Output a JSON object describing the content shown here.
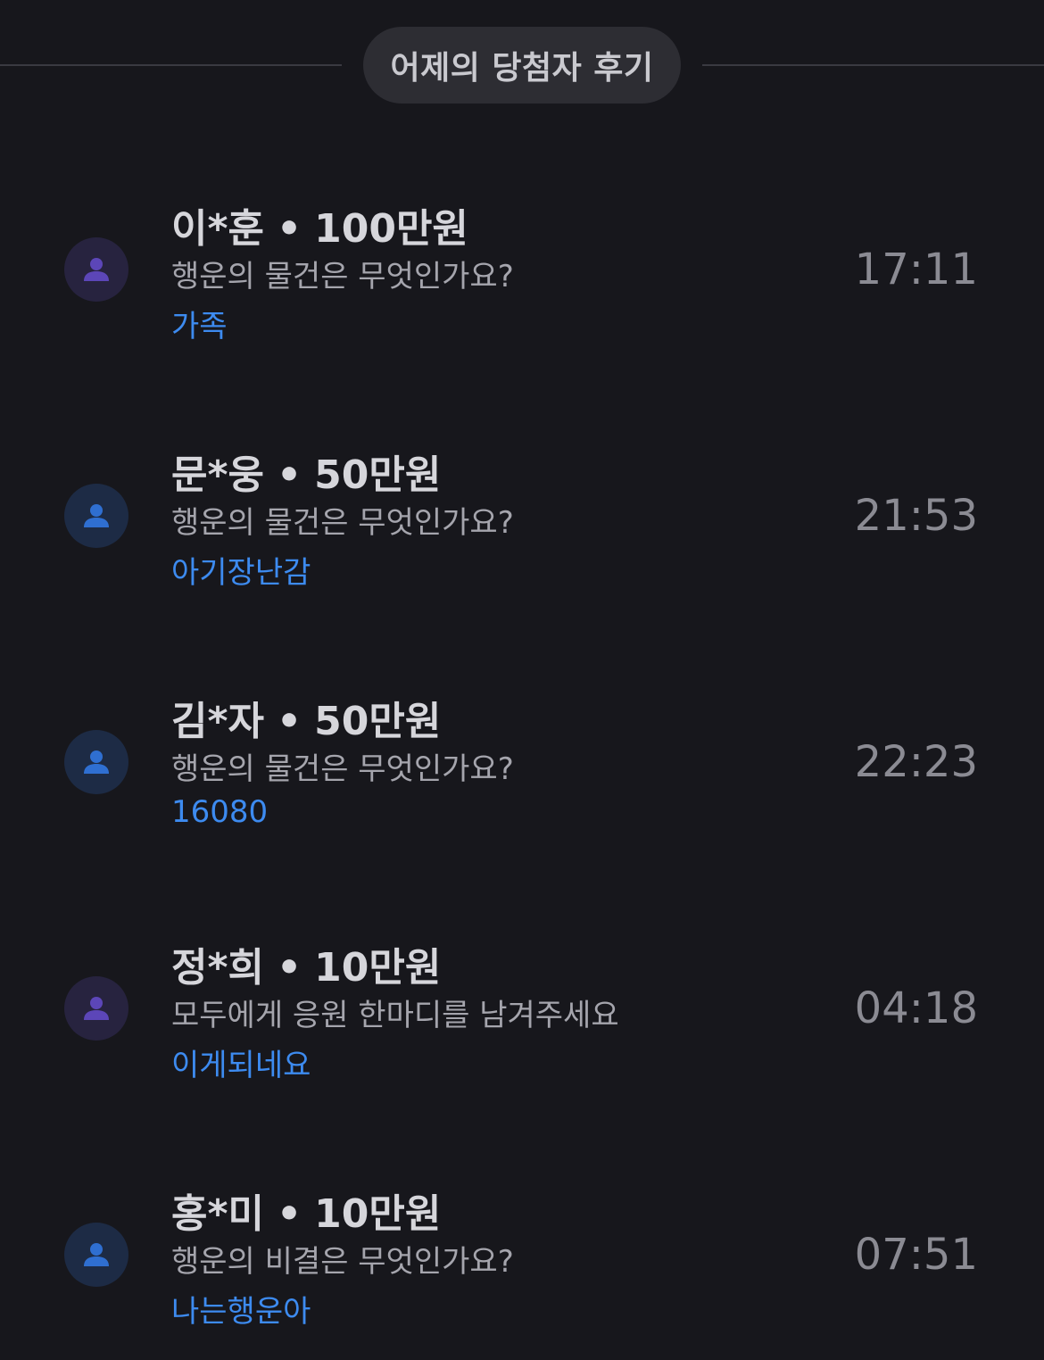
{
  "section": {
    "title": "어제의 당첨자 후기"
  },
  "reviews": [
    {
      "name": "이*훈",
      "separator": "•",
      "prize": "100만원",
      "question": "행운의 물건은 무엇인가요?",
      "answer": "가족",
      "time": "17:11",
      "avatar_bg": "#27233f",
      "avatar_fg": "#5c46b8"
    },
    {
      "name": "문*웅",
      "separator": "•",
      "prize": "50만원",
      "question": "행운의 물건은 무엇인가요?",
      "answer": "아기장난감",
      "time": "21:53",
      "avatar_bg": "#1d2b45",
      "avatar_fg": "#2f6fd1"
    },
    {
      "name": "김*자",
      "separator": "•",
      "prize": "50만원",
      "question": "행운의 물건은 무엇인가요?",
      "answer": "16080",
      "time": "22:23",
      "avatar_bg": "#1d2b45",
      "avatar_fg": "#2f6fd1"
    },
    {
      "name": "정*희",
      "separator": "•",
      "prize": "10만원",
      "question": "모두에게 응원 한마디를 남겨주세요",
      "answer": "이게되네요",
      "time": "04:18",
      "avatar_bg": "#27233f",
      "avatar_fg": "#5c46b8"
    },
    {
      "name": "홍*미",
      "separator": "•",
      "prize": "10만원",
      "question": "행운의 비결은 무엇인가요?",
      "answer": "나는행운아",
      "time": "07:51",
      "avatar_bg": "#1d2b45",
      "avatar_fg": "#2f6fd1"
    }
  ],
  "icons": {
    "avatar": "person-icon"
  }
}
